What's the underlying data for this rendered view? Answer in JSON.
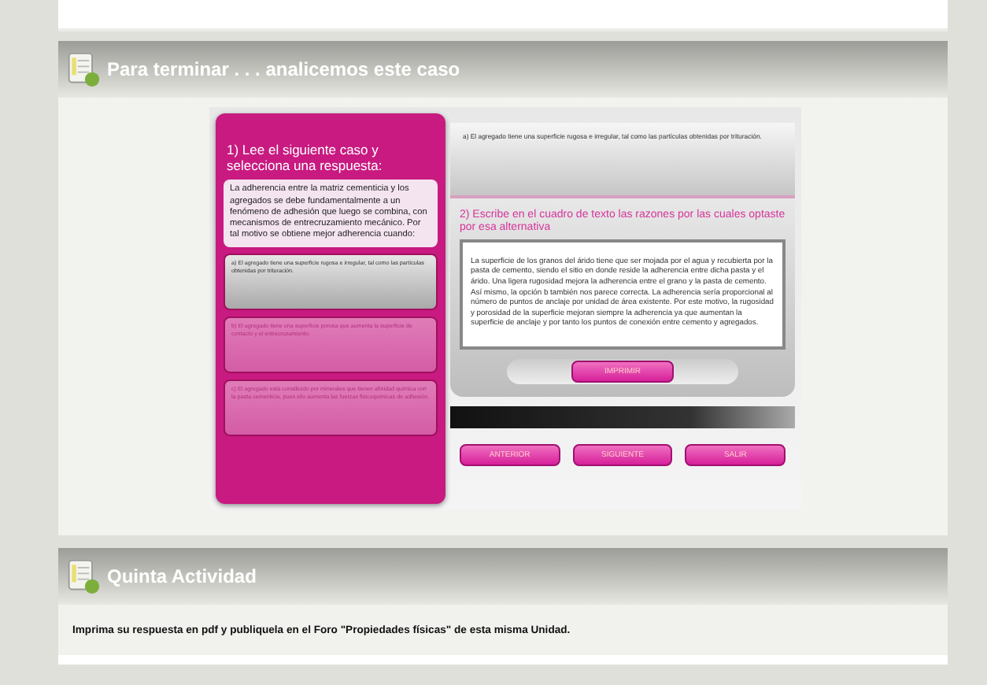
{
  "sections": [
    {
      "title": "Para terminar . . . analicemos este caso"
    },
    {
      "title": "Quinta Actividad",
      "text": "Imprima su respuesta en pdf y publiquela en el Foro \"Propiedades físicas\" de esta misma Unidad."
    }
  ],
  "activity": {
    "step1_title": "1) Lee el siguiente caso y selecciona una respuesta:",
    "case_text": "La adherencia entre la matriz cementicia y los agregados se debe fundamentalmente a un fenómeno de adhesión que luego se combina, con mecanismos de entrecruzamiento mecánico. Por tal motivo se obtiene mejor adherencia cuando:",
    "options": [
      {
        "text": "a) El agregado tiene una superficie rugosa e irregular, tal como las partículas obtenidas por trituración.",
        "selected": true
      },
      {
        "text": "b) El agregado tiene una superficie porosa que aumenta la superficie de contacto y el entrecruzamiento.",
        "selected": false
      },
      {
        "text": "c) El agregado está constituido por minerales que tienen afinidad química con la pasta cementicia, pues ello aumenta las fuerzas fisicoquímicas de adhesión.",
        "selected": false
      }
    ],
    "chosen_answer": "a) El agregado tiene una superficie rugosa e irregular, tal como las partículas obtenidas por trituración.",
    "step2_title": "2) Escribe en el cuadro de texto las razones por las cuales optaste por esa alternativa",
    "reason_text": "La superficie de los granos del árido tiene que ser mojada por el agua y recubierta por la pasta de cemento, siendo el sitio en donde reside la adherencia entre dicha pasta y el árido. Una ligera rugosidad mejora la adherencia entre el grano y la pasta de cemento. Así mismo, la opción b también nos parece correcta. La adherencia sería proporcional al número de puntos de anclaje por unidad de área existente. Por este motivo, la rugosidad y porosidad de la superficie mejoran siempre la adherencia ya que aumentan la superficie de anclaje y por tanto los puntos de conexión entre cemento y agregados.",
    "print_button": "IMPRIMIR",
    "nav_buttons": [
      "ANTERIOR",
      "SIGUIENTE",
      "SALIR"
    ]
  }
}
